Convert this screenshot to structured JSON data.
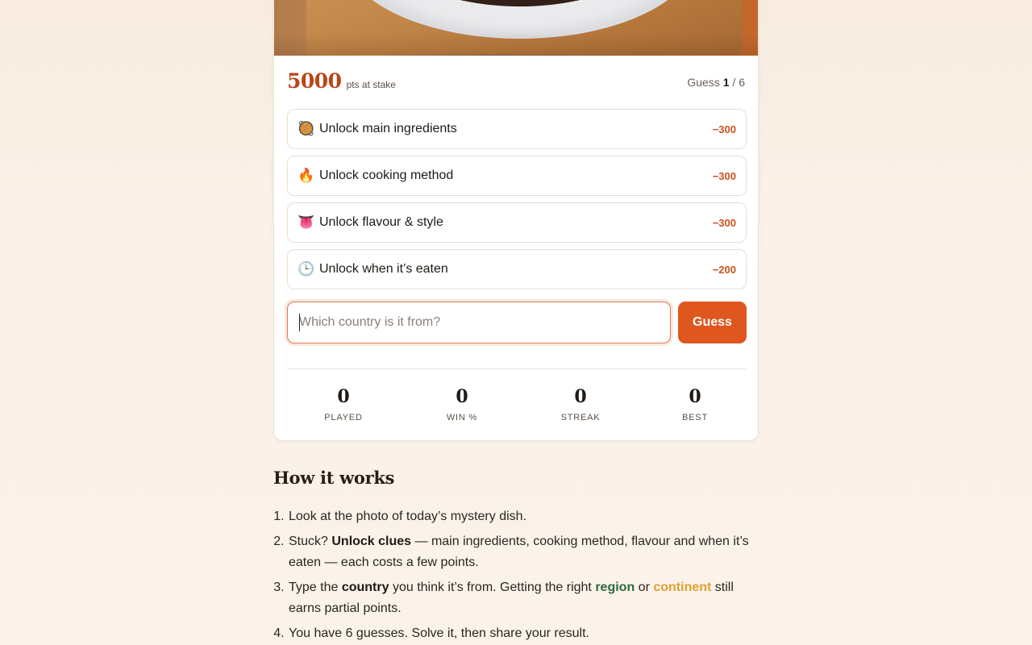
{
  "score": {
    "points": "5000",
    "points_label": "pts at stake",
    "guess_prefix": "Guess",
    "guess_current": "1",
    "guess_total": "/ 6"
  },
  "clues": [
    {
      "emoji": "🥘",
      "icon": "paella-pan-icon",
      "label": "Unlock main ingredients",
      "cost": "−300"
    },
    {
      "emoji": "🔥",
      "icon": "fire-icon",
      "label": "Unlock cooking method",
      "cost": "−300"
    },
    {
      "emoji": "👅",
      "icon": "tongue-icon",
      "label": "Unlock flavour & style",
      "cost": "−300"
    },
    {
      "emoji": "🕒",
      "icon": "clock-icon",
      "label": "Unlock when it’s eaten",
      "cost": "−200"
    }
  ],
  "guess": {
    "placeholder": "Which country is it from?",
    "value": "",
    "button_label": "Guess"
  },
  "stats": [
    {
      "value": "0",
      "label": "PLAYED"
    },
    {
      "value": "0",
      "label": "WIN %"
    },
    {
      "value": "0",
      "label": "STREAK"
    },
    {
      "value": "0",
      "label": "BEST"
    }
  ],
  "how_it_works": {
    "title": "How it works",
    "step1": "Look at the photo of today’s mystery dish.",
    "step2_a": "Stuck? ",
    "step2_b": "Unlock clues",
    "step2_c": " — main ingredients, cooking method, flavour and when it’s eaten — each costs a few points.",
    "step3_a": "Type the ",
    "step3_b": "country",
    "step3_c": " you think it’s from. Getting the right ",
    "step3_d": "region",
    "step3_e": " or ",
    "step3_f": "continent",
    "step3_g": " still earns partial points.",
    "step4": "You have 6 guesses. Solve it, then share your result."
  },
  "colors": {
    "accent": "#e0561f",
    "points": "#b84718",
    "cost": "#c9521c",
    "region": "#2e6b3f",
    "continent": "#e0a030"
  }
}
